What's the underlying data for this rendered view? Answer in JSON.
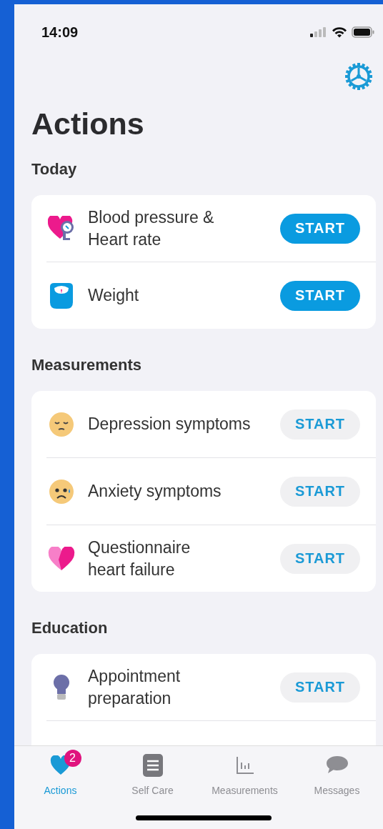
{
  "status_bar": {
    "time": "14:09"
  },
  "title": "Actions",
  "sections": [
    {
      "heading": "Today",
      "items": [
        {
          "title": "Blood pressure &\nHeart rate",
          "button": "START",
          "filled": true
        },
        {
          "title": "Weight",
          "button": "START",
          "filled": true
        }
      ]
    },
    {
      "heading": "Measurements",
      "items": [
        {
          "title": "Depression symptoms",
          "button": "START",
          "filled": false
        },
        {
          "title": "Anxiety symptoms",
          "button": "START",
          "filled": false
        },
        {
          "title": "Questionnaire\nheart failure",
          "button": "START",
          "filled": false
        }
      ]
    },
    {
      "heading": "Education",
      "items": [
        {
          "title": "Appointment\npreparation",
          "button": "START",
          "filled": false
        }
      ]
    }
  ],
  "tabs": [
    {
      "label": "Actions",
      "selected": true,
      "badge": "2"
    },
    {
      "label": "Self Care",
      "selected": false
    },
    {
      "label": "Measurements",
      "selected": false
    },
    {
      "label": "Messages",
      "selected": false
    }
  ]
}
